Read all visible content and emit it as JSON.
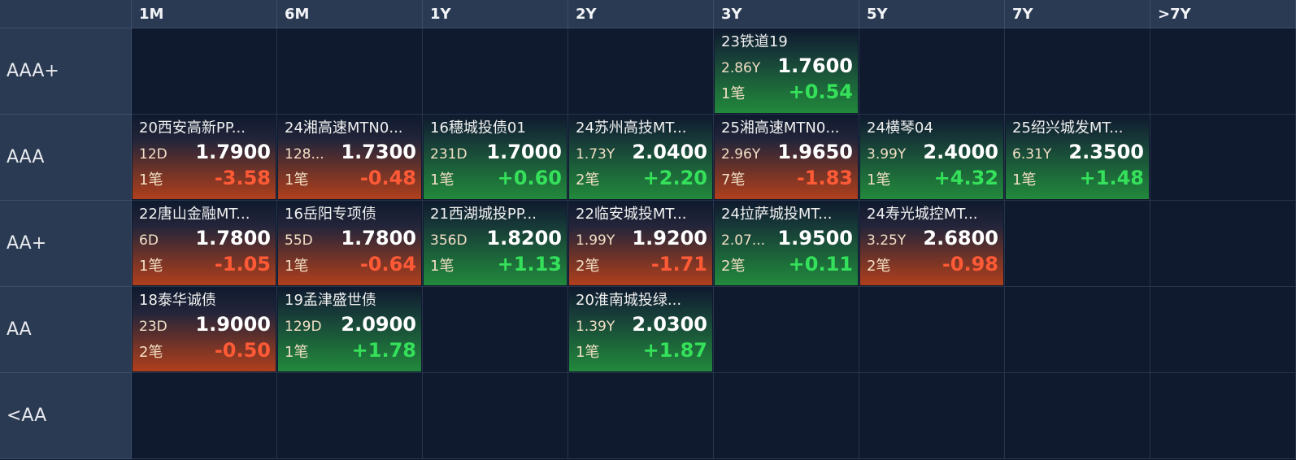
{
  "columns": [
    "1M",
    "6M",
    "1Y",
    "2Y",
    "3Y",
    "5Y",
    "7Y",
    ">7Y"
  ],
  "rows": [
    {
      "label": "AAA+",
      "cells": [
        null,
        null,
        null,
        null,
        {
          "name": "23铁道19",
          "term": "2.86Y",
          "price": "1.7600",
          "count": "1笔",
          "change": "+0.54",
          "dir": "pos"
        },
        null,
        null,
        null
      ]
    },
    {
      "label": "AAA",
      "cells": [
        {
          "name": "20西安高新PP...",
          "term": "12D",
          "price": "1.7900",
          "count": "1笔",
          "change": "-3.58",
          "dir": "neg"
        },
        {
          "name": "24湘高速MTN0...",
          "term": "128...",
          "price": "1.7300",
          "count": "1笔",
          "change": "-0.48",
          "dir": "neg"
        },
        {
          "name": "16穗城投债01",
          "term": "231D",
          "price": "1.7000",
          "count": "1笔",
          "change": "+0.60",
          "dir": "pos"
        },
        {
          "name": "24苏州高技MT...",
          "term": "1.73Y",
          "price": "2.0400",
          "count": "2笔",
          "change": "+2.20",
          "dir": "pos"
        },
        {
          "name": "25湘高速MTN0...",
          "term": "2.96Y",
          "price": "1.9650",
          "count": "7笔",
          "change": "-1.83",
          "dir": "neg"
        },
        {
          "name": "24横琴04",
          "term": "3.99Y",
          "price": "2.4000",
          "count": "1笔",
          "change": "+4.32",
          "dir": "pos"
        },
        {
          "name": "25绍兴城发MT...",
          "term": "6.31Y",
          "price": "2.3500",
          "count": "1笔",
          "change": "+1.48",
          "dir": "pos"
        },
        null
      ]
    },
    {
      "label": "AA+",
      "cells": [
        {
          "name": "22唐山金融MT...",
          "term": "6D",
          "price": "1.7800",
          "count": "1笔",
          "change": "-1.05",
          "dir": "neg"
        },
        {
          "name": "16岳阳专项债",
          "term": "55D",
          "price": "1.7800",
          "count": "1笔",
          "change": "-0.64",
          "dir": "neg"
        },
        {
          "name": "21西湖城投PP...",
          "term": "356D",
          "price": "1.8200",
          "count": "1笔",
          "change": "+1.13",
          "dir": "pos"
        },
        {
          "name": "22临安城投MT...",
          "term": "1.99Y",
          "price": "1.9200",
          "count": "2笔",
          "change": "-1.71",
          "dir": "neg"
        },
        {
          "name": "24拉萨城投MT...",
          "term": "2.07...",
          "price": "1.9500",
          "count": "2笔",
          "change": "+0.11",
          "dir": "pos"
        },
        {
          "name": "24寿光城控MT...",
          "term": "3.25Y",
          "price": "2.6800",
          "count": "2笔",
          "change": "-0.98",
          "dir": "neg"
        },
        null,
        null
      ]
    },
    {
      "label": "AA",
      "cells": [
        {
          "name": "18泰华诚债",
          "term": "23D",
          "price": "1.9000",
          "count": "2笔",
          "change": "-0.50",
          "dir": "neg"
        },
        {
          "name": "19孟津盛世债",
          "term": "129D",
          "price": "2.0900",
          "count": "1笔",
          "change": "+1.78",
          "dir": "pos"
        },
        null,
        {
          "name": "20淮南城投绿...",
          "term": "1.39Y",
          "price": "2.0300",
          "count": "1笔",
          "change": "+1.87",
          "dir": "pos"
        },
        null,
        null,
        null,
        null
      ]
    },
    {
      "label": "<AA",
      "cells": [
        null,
        null,
        null,
        null,
        null,
        null,
        null,
        null
      ]
    }
  ],
  "colors": {
    "header_bg": "#2a3a52",
    "grid_bg": "#0f1a2e",
    "negative": "#ff5a36",
    "positive": "#35e05a"
  }
}
